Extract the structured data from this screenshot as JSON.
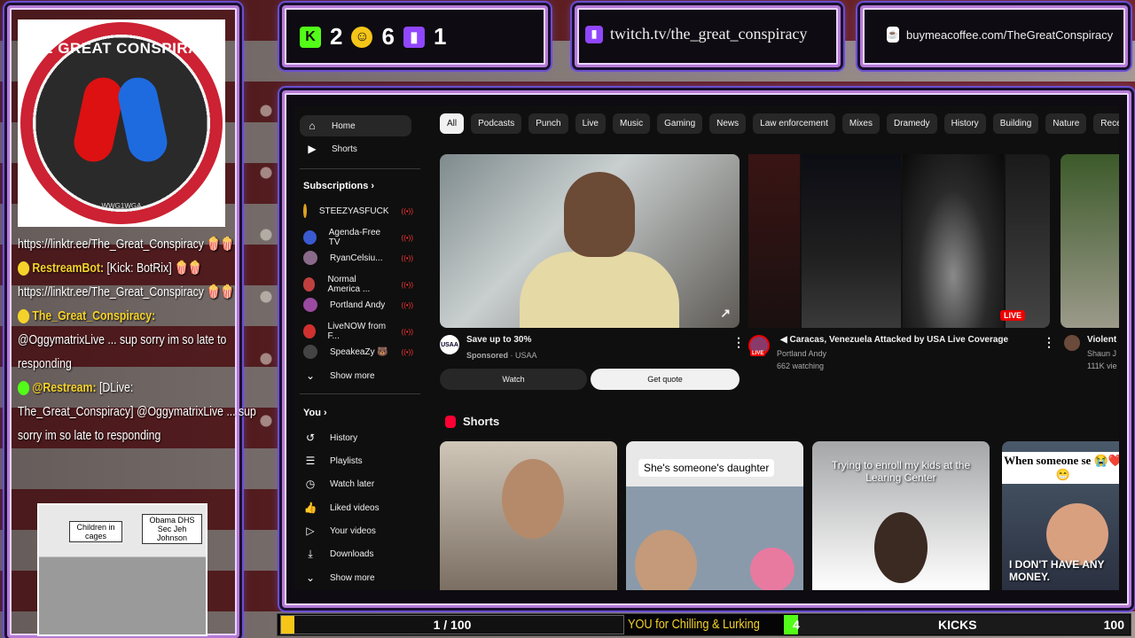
{
  "overlay": {
    "logo": {
      "title": "THE GREAT CONSPIRACY",
      "subtitle": "WWG1WGA"
    },
    "chat": [
      {
        "user": "",
        "text": "https://linktr.ee/The_Great_Conspiracy 🍿🍿"
      },
      {
        "user": "RestreamBot:",
        "text": "[Kick: BotRix] 🍿🍿"
      },
      {
        "user": "",
        "text": "https://linktr.ee/The_Great_Conspiracy 🍿🍿"
      },
      {
        "user": "The_Great_Conspiracy:",
        "text": ""
      },
      {
        "user": "",
        "text": "@OggymatrixLive ... sup sorry im so late to"
      },
      {
        "user": "",
        "text": "responding"
      },
      {
        "user": "@Restream:",
        "text": "[DLive:"
      },
      {
        "user": "",
        "text": "The_Great_Conspiracy] @OggymatrixLive ... sup"
      },
      {
        "user": "",
        "text": "sorry im so late to responding"
      }
    ],
    "thumb_captions": {
      "left": "Children in cages",
      "right": "Obama DHS Sec Jeh Johnson"
    },
    "counters": {
      "kick": "2",
      "face": "6",
      "twitch": "1"
    },
    "twitch_url": "twitch.tv/the_great_conspiracy",
    "coffee_url": "buymeacoffee.com/TheGreatConspiracy",
    "progress": {
      "label": "1 / 100",
      "current": 1,
      "max": 100
    },
    "ticker": "YOU for Chilling & Lurking! I  I Ma",
    "kicks": {
      "current": "4",
      "label": "KICKS",
      "max": "100"
    }
  },
  "youtube": {
    "sidebar": {
      "home": "Home",
      "shorts": "Shorts",
      "subscriptions_head": "Subscriptions",
      "subscriptions": [
        {
          "name": "STEEZYASFUCK",
          "color": "#e0a020"
        },
        {
          "name": "Agenda-Free TV",
          "color": "#3a5ad0"
        },
        {
          "name": "RyanCelsiu...",
          "color": "#8a6a8a"
        },
        {
          "name": "Normal America ...",
          "color": "#c04040"
        },
        {
          "name": "Portland Andy",
          "color": "#9a4aa0"
        },
        {
          "name": "LiveNOW from F...",
          "color": "#d03030"
        },
        {
          "name": "SpeakeaZy 🐻",
          "color": "#444444"
        }
      ],
      "show_more": "Show more",
      "you_head": "You",
      "you_items": [
        "History",
        "Playlists",
        "Watch later",
        "Liked videos",
        "Your videos",
        "Downloads"
      ],
      "show_more2": "Show more"
    },
    "chips": [
      "All",
      "Podcasts",
      "Punch",
      "Live",
      "Music",
      "Gaming",
      "News",
      "Law enforcement",
      "Mixes",
      "Dramedy",
      "History",
      "Building",
      "Nature",
      "Recently uploaded"
    ],
    "ad": {
      "title": "Save up to 30%",
      "sponsored": "Sponsored",
      "advertiser": "USAA",
      "watch": "Watch",
      "quote": "Get quote"
    },
    "live": {
      "title": "Caracas, Venezuela Attacked by USA Live Coverage",
      "channel": "Portland Andy",
      "watching": "662 watching",
      "badge": "LIVE"
    },
    "third": {
      "title": "Violent",
      "channel": "Shaun J",
      "views": "111K vie"
    },
    "shorts_head": "Shorts",
    "shorts": [
      {
        "caption": ""
      },
      {
        "caption": "She's someone's daughter"
      },
      {
        "caption": "Trying to enroll my kids at the Learing Center"
      },
      {
        "caption": "When someone se 😭❤️😁",
        "bottom": "I DON'T HAVE ANY MONEY."
      }
    ]
  }
}
